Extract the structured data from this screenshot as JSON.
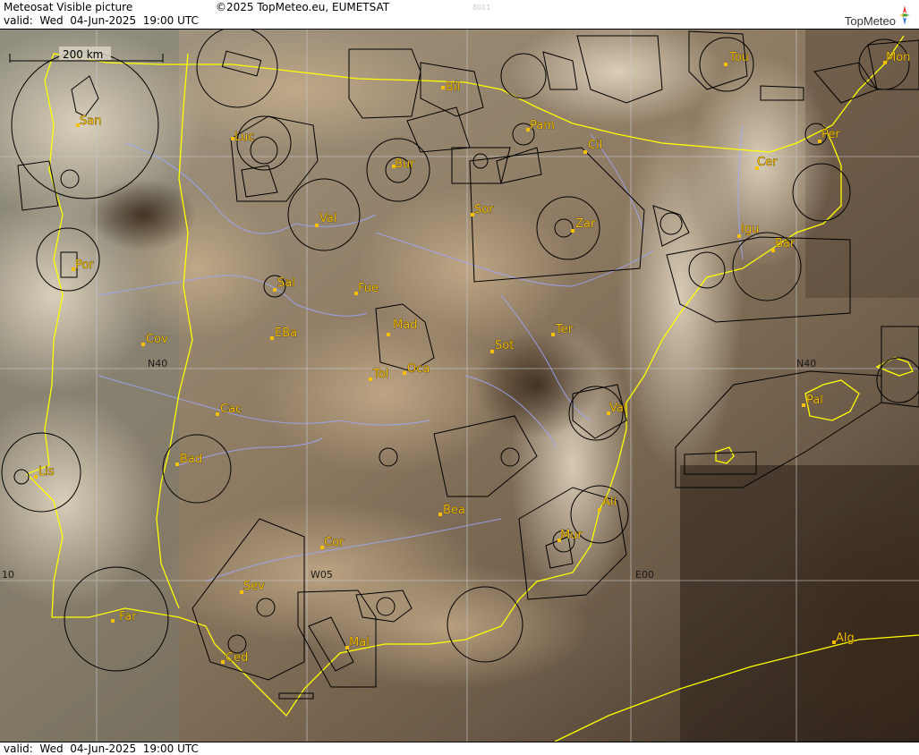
{
  "header": {
    "title": "Meteosat Visible picture",
    "valid": "valid:  Wed  04-Jun-2025  19:00 UTC",
    "copyright": "©2025 TopMeteo.eu, EUMETSAT",
    "code": "8011",
    "logo_text": "TopMeteo"
  },
  "footer": {
    "valid": "valid:  Wed  04-Jun-2025  19:00 UTC"
  },
  "map": {
    "scale_label": "200 km",
    "grid_labels": [
      "N40",
      "N40",
      "W05",
      "E00",
      "10"
    ],
    "cities": [
      "Bil",
      "Tou",
      "Mon",
      "Pam",
      "San",
      "Luc",
      "Bur",
      "Cil",
      "Per",
      "Cer",
      "Sor",
      "Val",
      "Zar",
      "Igu",
      "Bar",
      "Por",
      "Sal",
      "Fue",
      "Mad",
      "EBa",
      "Cov",
      "Ter",
      "Sot",
      "Tol",
      "Oca",
      "Pal",
      "Cac",
      "Val",
      "Lis",
      "Bad",
      "Ali",
      "Bea",
      "Mur",
      "Cor",
      "Sev",
      "Far",
      "Mal",
      "Ced",
      "Alg"
    ],
    "colors": {
      "coast": "#ffff00",
      "airspace": "#000000",
      "city": "#f5c000",
      "grid": "#c8c8c8",
      "river": "#9ba8ff"
    }
  }
}
